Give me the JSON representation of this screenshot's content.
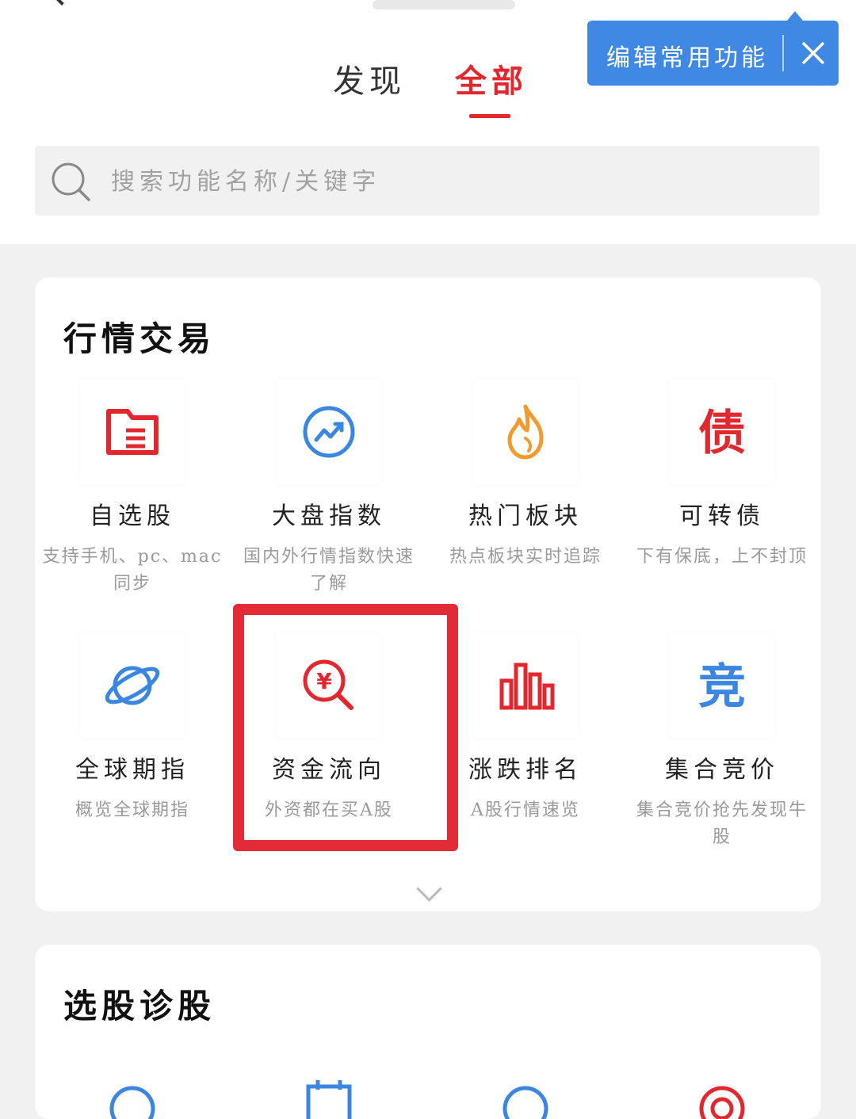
{
  "header": {
    "tabs": [
      {
        "label": "发现"
      },
      {
        "label": "全部",
        "active": true
      }
    ]
  },
  "popup": {
    "label": "编辑常用功能",
    "close_icon": "close-icon"
  },
  "search": {
    "placeholder": "搜索功能名称/关键字",
    "icon": "search-icon"
  },
  "sections": [
    {
      "title": "行情交易",
      "items": [
        {
          "name": "自选股",
          "desc": "支持手机、pc、mac同步",
          "icon": "folder-icon",
          "color": "#e2282e"
        },
        {
          "name": "大盘指数",
          "desc": "国内外行情指数快速了解",
          "icon": "trend-icon",
          "color": "#3a86e0"
        },
        {
          "name": "热门板块",
          "desc": "热点板块实时追踪",
          "icon": "flame-icon",
          "color": "#f29a2e"
        },
        {
          "name": "可转债",
          "desc": "下有保底，上不封顶",
          "icon": "bond-icon",
          "color": "#e2282e",
          "glyph": "债"
        },
        {
          "name": "全球期指",
          "desc": "概览全球期指",
          "icon": "planet-icon",
          "color": "#3a86e0"
        },
        {
          "name": "资金流向",
          "desc": "外资都在买A股",
          "icon": "money-search-icon",
          "color": "#e2282e",
          "highlighted": true
        },
        {
          "name": "涨跌排名",
          "desc": "A股行情速览",
          "icon": "bar-chart-icon",
          "color": "#e2282e"
        },
        {
          "name": "集合竞价",
          "desc": "集合竞价抢先发现牛股",
          "icon": "auction-icon",
          "color": "#3a86e0",
          "glyph": "竞"
        }
      ]
    },
    {
      "title": "选股诊股"
    }
  ],
  "colors": {
    "accent": "#e2282e",
    "blue": "#3f88e4",
    "highlight": "#e32a37"
  }
}
